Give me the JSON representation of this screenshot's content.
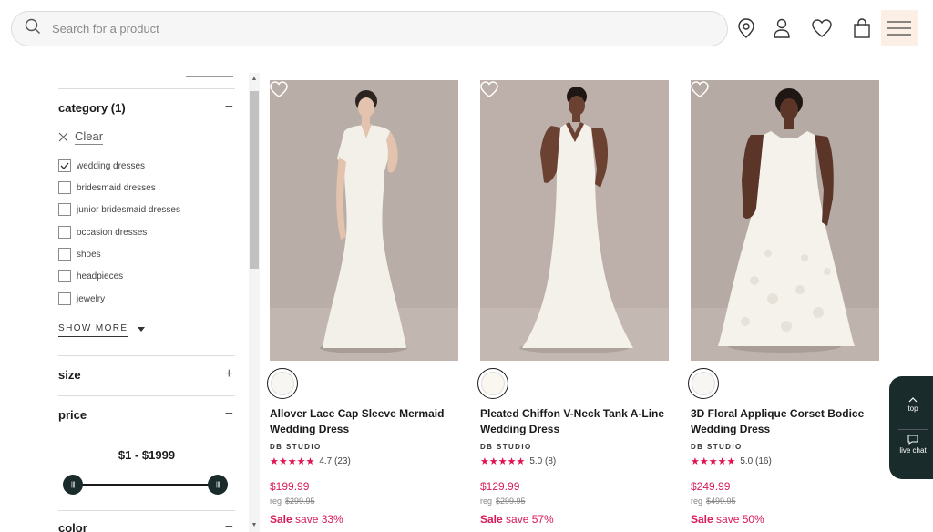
{
  "header": {
    "search_placeholder": "Search for a product"
  },
  "filters": {
    "category": {
      "title": "category (1)",
      "toggle": "−",
      "clear_label": "Clear",
      "items": [
        {
          "label": "wedding dresses",
          "checked": true
        },
        {
          "label": "bridesmaid dresses",
          "checked": false
        },
        {
          "label": "junior bridesmaid dresses",
          "checked": false
        },
        {
          "label": "occasion dresses",
          "checked": false
        },
        {
          "label": "shoes",
          "checked": false
        },
        {
          "label": "headpieces",
          "checked": false
        },
        {
          "label": "jewelry",
          "checked": false
        }
      ],
      "show_more": "SHOW MORE"
    },
    "size": {
      "title": "size",
      "toggle": "+"
    },
    "price": {
      "title": "price",
      "toggle": "−",
      "range": "$1 - $1999",
      "min": 1,
      "max": 1999
    },
    "color": {
      "title": "color",
      "toggle": "−"
    }
  },
  "products": [
    {
      "name": "Allover Lace Cap Sleeve Mermaid Wedding Dress",
      "brand": "DB STUDIO",
      "stars": "★★★★★",
      "rating": 4.7,
      "rating_text": "4.7 (23)",
      "price": "$199.99",
      "reg_label": "reg",
      "reg_price": "$299.95",
      "sale_word": "Sale",
      "sale_text": "save 33%"
    },
    {
      "name": "Pleated Chiffon V-Neck Tank A-Line Wedding Dress",
      "brand": "DB STUDIO",
      "stars": "★★★★★",
      "rating": 5.0,
      "rating_text": "5.0 (8)",
      "price": "$129.99",
      "reg_label": "reg",
      "reg_price": "$299.95",
      "sale_word": "Sale",
      "sale_text": "save 57%"
    },
    {
      "name": "3D Floral Applique Corset Bodice Wedding Dress",
      "brand": "DB STUDIO",
      "stars": "★★★★★",
      "rating": 5.0,
      "rating_text": "5.0 (16)",
      "price": "$249.99",
      "reg_label": "reg",
      "reg_price": "$499.95",
      "sale_word": "Sale",
      "sale_text": "save 50%"
    }
  ],
  "widget": {
    "top_label": "top",
    "chat_label": "live chat"
  },
  "colors": {
    "accent_pink": "#d81b56",
    "dark_teal": "#1a2b2b",
    "menu_bg": "#fbefe6",
    "image_bg": "#b8aca6"
  }
}
